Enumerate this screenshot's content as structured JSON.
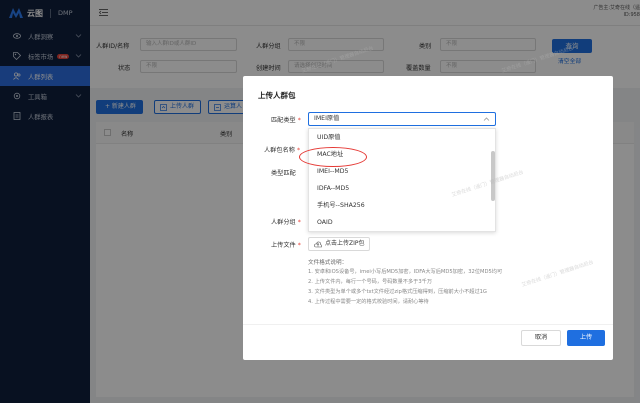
{
  "brand": {
    "name": "云图",
    "product": "DMP"
  },
  "sidebar": {
    "items": [
      {
        "label": "人群洞察",
        "icon": "eye-icon",
        "has_caret": true,
        "active": false,
        "badge": ""
      },
      {
        "label": "标签市场",
        "icon": "tag-icon",
        "has_caret": true,
        "active": false,
        "badge": "new"
      },
      {
        "label": "人群列表",
        "icon": "users-icon",
        "has_caret": false,
        "active": true,
        "badge": ""
      },
      {
        "label": "工具箱",
        "icon": "gear-icon",
        "has_caret": true,
        "active": false,
        "badge": ""
      },
      {
        "label": "人群报表",
        "icon": "report-icon",
        "has_caret": false,
        "active": false,
        "badge": ""
      }
    ]
  },
  "topbar": {
    "account_line1": "广告主:艾奇在线（遥",
    "account_line2": "ID:958"
  },
  "filter": {
    "id_name_label": "人群ID/名称",
    "id_name_placeholder": "输入人群ID或人群ID",
    "group_label": "人群分组",
    "group_value": "不限",
    "category_label": "类别",
    "category_value": "不限",
    "status_label": "状态",
    "status_value": "不限",
    "created_label": "创建时间",
    "created_placeholder": "请选择创建时间",
    "coverage_label": "覆盖数量",
    "coverage_value": "不限",
    "query_label": "查询",
    "clear_label": "清空全部"
  },
  "toolbar": {
    "new_label": "+ 新建人群",
    "upload_label": "上传人群",
    "compute_label": "运算人"
  },
  "table": {
    "headers": [
      "名称",
      "类别"
    ]
  },
  "modal": {
    "title": "上传人群包",
    "match_type_label": "匹配类型",
    "match_type_value": "IMEI原值",
    "options": [
      "UID原值",
      "MAC地址",
      "IMEI--MD5",
      "IDFA--MD5",
      "手机号--SHA256",
      "OAID"
    ],
    "name_label": "人群包名称",
    "type_match_label": "类型匹配",
    "group_label": "人群分组",
    "upload_label": "上传文件",
    "upload_button": "点击上传ZIP包",
    "format_title": "文件格式说明：",
    "format_lines": [
      "1. 安卓和iOS设备号，imei小写后MD5加密，IDFA大写后MD5加密，32位MD5均可",
      "2. 上传文件内，每行一个号码，号码数量不多于3千万",
      "3. 文件类型为单个或多个txt文件经过zip格式压缩得到，压缩前大小不超过1G",
      "4. 上传过程中需要一定的格式校验时间，请耐心等待"
    ],
    "cancel_label": "取消",
    "submit_label": "上传"
  },
  "watermark_text": "艾奇在线（遥门）管理器自动后台",
  "colors": {
    "primary": "#1f6fe0",
    "sidebar": "#0f1f3d",
    "highlight": "#e53935"
  }
}
